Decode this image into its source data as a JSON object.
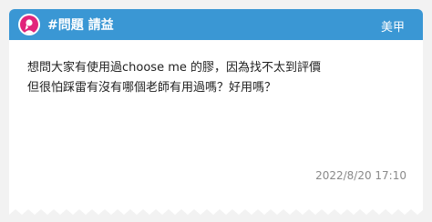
{
  "header": {
    "title": "#問題 請益",
    "author": "美甲",
    "accent_color": "#3a97d4",
    "avatar_icon": "female-silhouette-icon",
    "avatar_color": "#e1247b"
  },
  "post": {
    "lines": [
      "想問大家有使用過choose me 的膠，因為找不太到評價",
      "但很怕踩雷有沒有哪個老師有用過嗎？好用嗎？"
    ],
    "timestamp": "2022/8/20 17:10"
  }
}
